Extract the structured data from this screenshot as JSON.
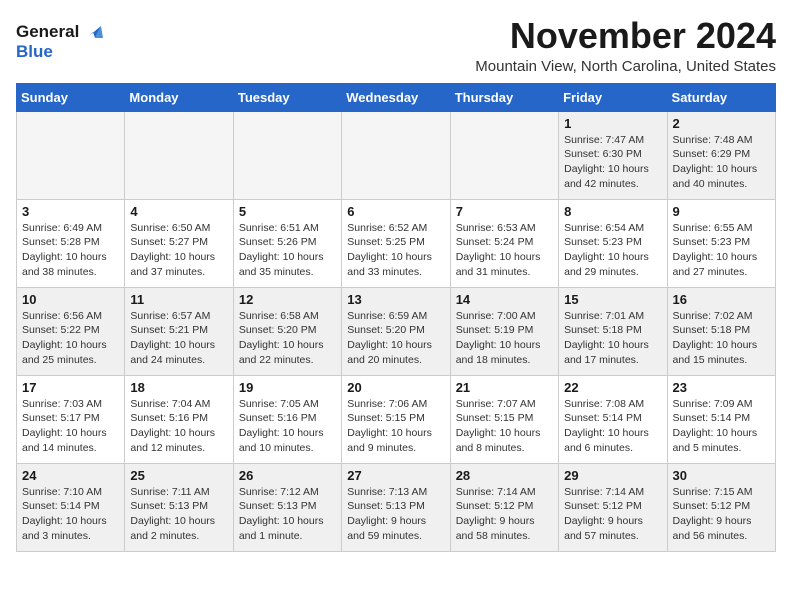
{
  "logo": {
    "line1": "General",
    "line2": "Blue"
  },
  "title": "November 2024",
  "location": "Mountain View, North Carolina, United States",
  "weekdays": [
    "Sunday",
    "Monday",
    "Tuesday",
    "Wednesday",
    "Thursday",
    "Friday",
    "Saturday"
  ],
  "weeks": [
    [
      {
        "day": "",
        "detail": ""
      },
      {
        "day": "",
        "detail": ""
      },
      {
        "day": "",
        "detail": ""
      },
      {
        "day": "",
        "detail": ""
      },
      {
        "day": "",
        "detail": ""
      },
      {
        "day": "1",
        "detail": "Sunrise: 7:47 AM\nSunset: 6:30 PM\nDaylight: 10 hours\nand 42 minutes."
      },
      {
        "day": "2",
        "detail": "Sunrise: 7:48 AM\nSunset: 6:29 PM\nDaylight: 10 hours\nand 40 minutes."
      }
    ],
    [
      {
        "day": "3",
        "detail": "Sunrise: 6:49 AM\nSunset: 5:28 PM\nDaylight: 10 hours\nand 38 minutes."
      },
      {
        "day": "4",
        "detail": "Sunrise: 6:50 AM\nSunset: 5:27 PM\nDaylight: 10 hours\nand 37 minutes."
      },
      {
        "day": "5",
        "detail": "Sunrise: 6:51 AM\nSunset: 5:26 PM\nDaylight: 10 hours\nand 35 minutes."
      },
      {
        "day": "6",
        "detail": "Sunrise: 6:52 AM\nSunset: 5:25 PM\nDaylight: 10 hours\nand 33 minutes."
      },
      {
        "day": "7",
        "detail": "Sunrise: 6:53 AM\nSunset: 5:24 PM\nDaylight: 10 hours\nand 31 minutes."
      },
      {
        "day": "8",
        "detail": "Sunrise: 6:54 AM\nSunset: 5:23 PM\nDaylight: 10 hours\nand 29 minutes."
      },
      {
        "day": "9",
        "detail": "Sunrise: 6:55 AM\nSunset: 5:23 PM\nDaylight: 10 hours\nand 27 minutes."
      }
    ],
    [
      {
        "day": "10",
        "detail": "Sunrise: 6:56 AM\nSunset: 5:22 PM\nDaylight: 10 hours\nand 25 minutes."
      },
      {
        "day": "11",
        "detail": "Sunrise: 6:57 AM\nSunset: 5:21 PM\nDaylight: 10 hours\nand 24 minutes."
      },
      {
        "day": "12",
        "detail": "Sunrise: 6:58 AM\nSunset: 5:20 PM\nDaylight: 10 hours\nand 22 minutes."
      },
      {
        "day": "13",
        "detail": "Sunrise: 6:59 AM\nSunset: 5:20 PM\nDaylight: 10 hours\nand 20 minutes."
      },
      {
        "day": "14",
        "detail": "Sunrise: 7:00 AM\nSunset: 5:19 PM\nDaylight: 10 hours\nand 18 minutes."
      },
      {
        "day": "15",
        "detail": "Sunrise: 7:01 AM\nSunset: 5:18 PM\nDaylight: 10 hours\nand 17 minutes."
      },
      {
        "day": "16",
        "detail": "Sunrise: 7:02 AM\nSunset: 5:18 PM\nDaylight: 10 hours\nand 15 minutes."
      }
    ],
    [
      {
        "day": "17",
        "detail": "Sunrise: 7:03 AM\nSunset: 5:17 PM\nDaylight: 10 hours\nand 14 minutes."
      },
      {
        "day": "18",
        "detail": "Sunrise: 7:04 AM\nSunset: 5:16 PM\nDaylight: 10 hours\nand 12 minutes."
      },
      {
        "day": "19",
        "detail": "Sunrise: 7:05 AM\nSunset: 5:16 PM\nDaylight: 10 hours\nand 10 minutes."
      },
      {
        "day": "20",
        "detail": "Sunrise: 7:06 AM\nSunset: 5:15 PM\nDaylight: 10 hours\nand 9 minutes."
      },
      {
        "day": "21",
        "detail": "Sunrise: 7:07 AM\nSunset: 5:15 PM\nDaylight: 10 hours\nand 8 minutes."
      },
      {
        "day": "22",
        "detail": "Sunrise: 7:08 AM\nSunset: 5:14 PM\nDaylight: 10 hours\nand 6 minutes."
      },
      {
        "day": "23",
        "detail": "Sunrise: 7:09 AM\nSunset: 5:14 PM\nDaylight: 10 hours\nand 5 minutes."
      }
    ],
    [
      {
        "day": "24",
        "detail": "Sunrise: 7:10 AM\nSunset: 5:14 PM\nDaylight: 10 hours\nand 3 minutes."
      },
      {
        "day": "25",
        "detail": "Sunrise: 7:11 AM\nSunset: 5:13 PM\nDaylight: 10 hours\nand 2 minutes."
      },
      {
        "day": "26",
        "detail": "Sunrise: 7:12 AM\nSunset: 5:13 PM\nDaylight: 10 hours\nand 1 minute."
      },
      {
        "day": "27",
        "detail": "Sunrise: 7:13 AM\nSunset: 5:13 PM\nDaylight: 9 hours\nand 59 minutes."
      },
      {
        "day": "28",
        "detail": "Sunrise: 7:14 AM\nSunset: 5:12 PM\nDaylight: 9 hours\nand 58 minutes."
      },
      {
        "day": "29",
        "detail": "Sunrise: 7:14 AM\nSunset: 5:12 PM\nDaylight: 9 hours\nand 57 minutes."
      },
      {
        "day": "30",
        "detail": "Sunrise: 7:15 AM\nSunset: 5:12 PM\nDaylight: 9 hours\nand 56 minutes."
      }
    ]
  ]
}
